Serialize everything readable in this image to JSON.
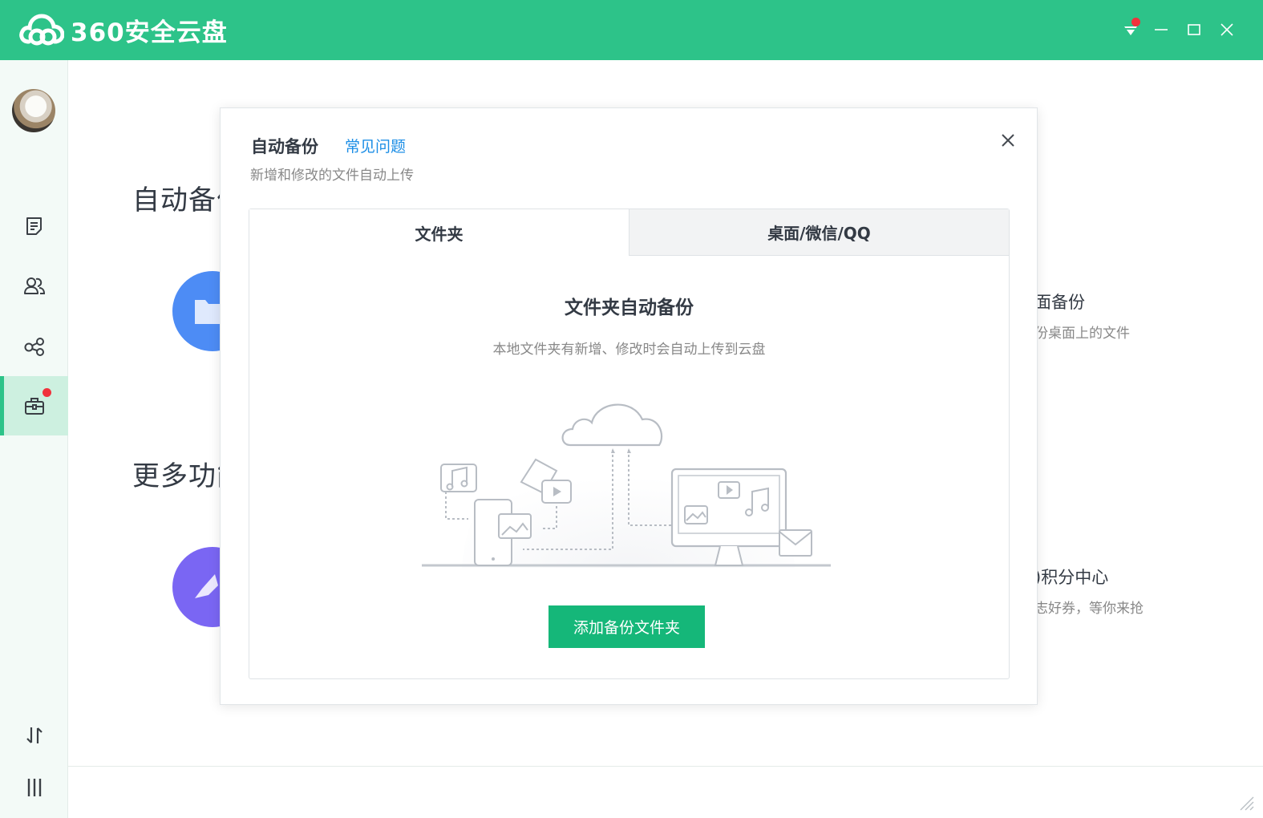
{
  "app": {
    "title": "360安全云盘",
    "brand_color": "#2dc389"
  },
  "window_controls": [
    "skin-icon",
    "minimize-icon",
    "maximize-icon",
    "close-icon"
  ],
  "sidebar": {
    "items": [
      {
        "name": "file-list",
        "icon": "document-icon"
      },
      {
        "name": "contacts",
        "icon": "users-icon"
      },
      {
        "name": "share",
        "icon": "share-icon"
      },
      {
        "name": "toolbox",
        "icon": "toolbox-icon",
        "active": true,
        "badge": true
      }
    ],
    "bottom_items": [
      {
        "name": "transfer",
        "icon": "transfer-icon"
      },
      {
        "name": "menu",
        "icon": "menu-icon"
      }
    ]
  },
  "background": {
    "section1_title": "自动备份",
    "section2_title": "更多功能",
    "right_item1_title": "面备份",
    "right_item1_sub": "份桌面上的文件",
    "right_item2_title": ")积分中心",
    "right_item2_sub": "志好券，等你来抢"
  },
  "modal": {
    "title": "自动备份",
    "faq_link": "常见问题",
    "description": "新增和修改的文件自动上传",
    "tabs": [
      {
        "label": "文件夹",
        "active": true
      },
      {
        "label": "桌面/微信/QQ",
        "active": false
      }
    ],
    "heading": "文件夹自动备份",
    "subheading": "本地文件夹有新增、修改时会自动上传到云盘",
    "button_label": "添加备份文件夹"
  }
}
